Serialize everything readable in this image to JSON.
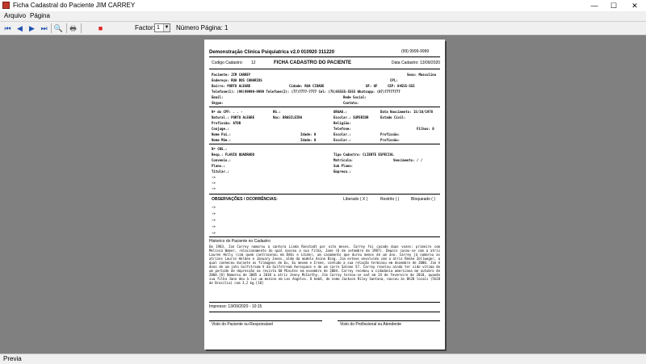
{
  "window": {
    "title": "Ficha Cadastral do Paciente JIM CARREY",
    "minimize": "—",
    "maximize": "☐",
    "close": "✕"
  },
  "menu": {
    "items": [
      "Arquivo",
      "Página"
    ]
  },
  "toolbar": {
    "first": "⏮",
    "prev": "◀",
    "next": "▶",
    "last": "⏭",
    "zoom": "🔍",
    "print": "🖶",
    "close_preview": "■",
    "factor_label": "Factor:",
    "factor_value": "1",
    "page_label": "Número Página: 1"
  },
  "report": {
    "clinic": "Demonstração Clinica Psiquiatrica v2.0 010920 311220",
    "phone": "(99) 9999-9999",
    "code_label": "Codigo Cadastro:",
    "code_value": "12",
    "form_title": "FICHA CADASTRO DO PACIENTE",
    "date": "Data Cadastro: 13/09/2020",
    "fields": {
      "paciente": "Paciente: JIM CARREY",
      "sexo": "Sexo: Masculino",
      "endereco": "Endereço: RUA DOS CANARIOS",
      "cpl": "CPL:",
      "bairro": "Bairro: PORTO ALEGRE",
      "cidade": "Cidade: RUA CIDADE",
      "uf": "UF: UF",
      "cep": "CEP: 84555-555",
      "telefones": "Telefone(1): (99)99999-9999  Telefone(2): (77)7777-7777  Cel: (75)85555-5555  Whatsapp: (87)77777777",
      "email": "Email:",
      "rede": "Rede Social:",
      "skype": "Skype:",
      "contato": "Contato:",
      "cpf": "Nº do CPF: . . -",
      "rg": "RG.:",
      "orgao": "ORGAO.:",
      "nascimento": "Data Nascimento: 15/10/1978",
      "natural": "Natural.: PORTO ALEGRE",
      "nac": "Nac: BRASILEIRA",
      "escolar": "Escolar.: SUPERIOR",
      "civil": "Estado Civil:",
      "profissao": "Profissão: ATOR",
      "religiao": "Religião:",
      "conjuge": "Conjuge.:",
      "telefone": "Telefone:",
      "filhos": "Filhos: 0",
      "pai": "Nome Pai.:",
      "idade_pai": "Idade: 0",
      "escolar_pai": "Escolar.:",
      "prof_pai": "Profissão:",
      "mae": "Nome Mãe.:",
      "idade_mae": "Idade: 0",
      "escolar_mae": "Escolar.:",
      "prof_mae": "Profissão:",
      "cns": "Nº CNS.:",
      "resp": "Resp.: FLAVIO QUADRADO",
      "tipo": "Tipo Cadastro: CLIENTE ESPECIAL",
      "convenio": "Convenio.:",
      "matricula": "Matricula:",
      "vencimento": "Vencimento: / /",
      "plano": "Plano.:",
      "subplano": "Sub Plano:",
      "titular": "Titular.:",
      "empresa": "Empresa.:",
      "arrow": "->"
    },
    "obs_label": "OBSERVAÇÕES / OCORRÊNCIAS:",
    "liberado": "Liberado ( X )",
    "restrito": "Restrito (   )",
    "bloqueado": "Bloqueado (   )",
    "history_title": "Historico do Paciente no Cadastro",
    "history_text": "Em 1983, Jim Carrey namorou a cantora Linda Ronstadt por oito meses. Carrey foi casado duas vezes: primeiro com Melissa Womer, relacionamento do qual nasceu a sua filha, Jane (6 de setembro de 1987). Depois casou-se com a atriz Lauren Holly (com quem contracenou em Débi e Lóide), um casamento que durou menos de um ano. Carrey já namorou as atrizes Laurie Holden e January Jones, além da modelo Anine Bing. Jim esteve envolvido com a atriz Renée Zellweger, a qual conheceu durante as filmagens de Eu, Eu mesmo e Irene, contudo a sua relação terminou em dezembro de 2000. Jim é dono de um jato Gulfstream V da Gulfstream Aerospace e de um carro Saleen S7. Carrey revelou ainda ter sido vítima de um período de depressão na revista 60 Minutes em novembro de 2004. Carrey recebeu a cidadania americana em outubro de 2004.[8] Namorou de 2005 a 2010 a atriz Jenny McCarthy. Jim Carrey tornou-se avô em 24 de fevereiro de 2010, quando sua filha Jane deu à luz um menino em Los Angeles. O bebê, de nome Jackson Riley Santana, nasceu às 0h28 locais (5h28 de Brasília) com 3,2 kg.[10]",
    "impresso": "Impresso: 13/09/2020 - 10:15",
    "sign_patient": "Visto do Paciente ou Responsável",
    "sign_professional": "Visto do Profissional ou Atendente"
  },
  "status": {
    "text": "Previa"
  }
}
